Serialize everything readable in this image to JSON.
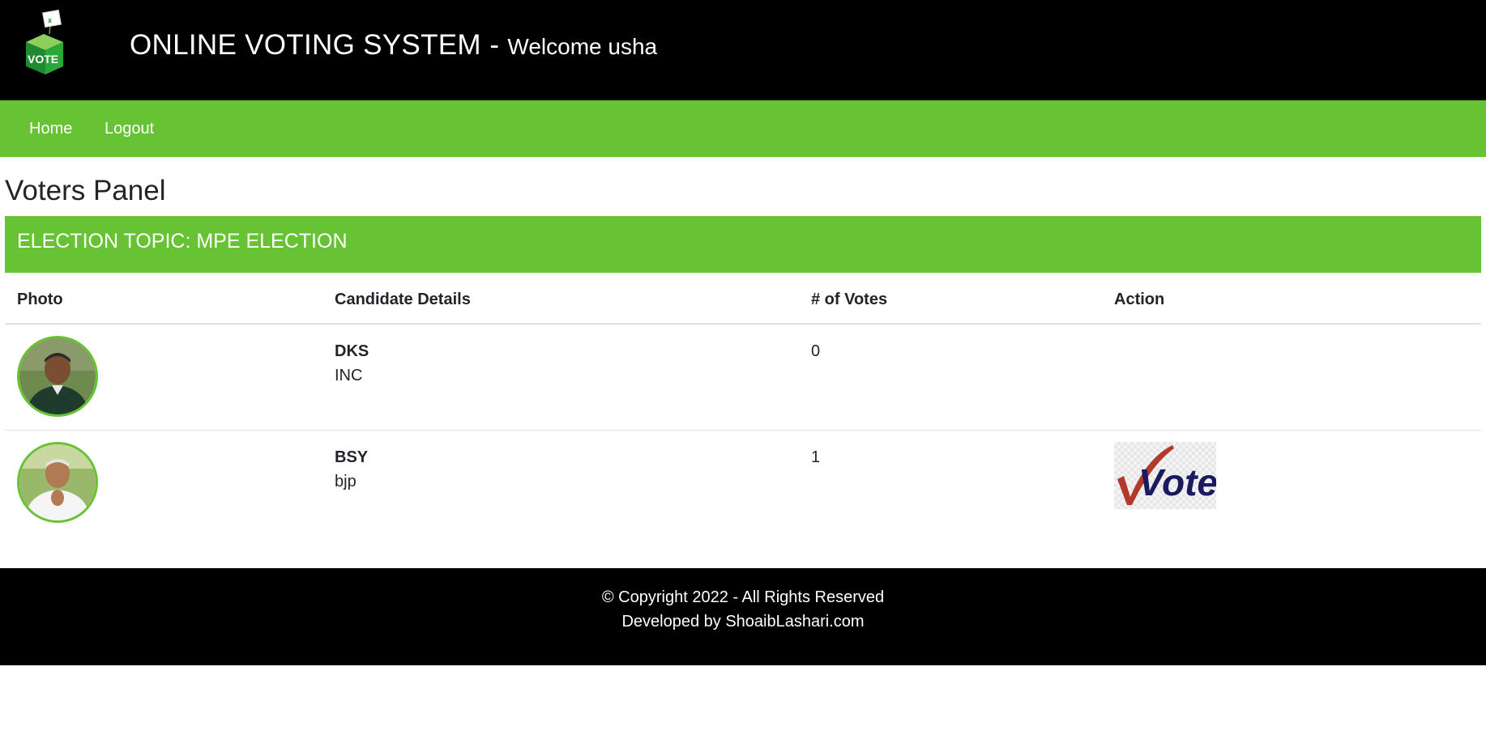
{
  "header": {
    "title": "ONLINE VOTING SYSTEM",
    "separator": "-",
    "welcome": "Welcome usha",
    "logo_icon": "vote-box-logo",
    "logo_text": "VOTE",
    "colors": {
      "background": "#000000",
      "accent": "#67c334"
    }
  },
  "nav": {
    "home": "Home",
    "logout": "Logout"
  },
  "page": {
    "title": "Voters Panel"
  },
  "election": {
    "topic": "ELECTION TOPIC: MPE ELECTION"
  },
  "table": {
    "headers": {
      "photo": "Photo",
      "details": "Candidate Details",
      "votes": "# of Votes",
      "action": "Action"
    },
    "rows": [
      {
        "name": "DKS",
        "party": "INC",
        "votes": "0",
        "photo_icon": "candidate-photo",
        "action": ""
      },
      {
        "name": "BSY",
        "party": "bjp",
        "votes": "1",
        "photo_icon": "candidate-photo",
        "action": "vote-button-image"
      }
    ]
  },
  "vote_image": {
    "text": "Vote",
    "icon": "checkmark-icon"
  },
  "footer": {
    "copyright": "© Copyright 2022 - All Rights Reserved",
    "developer": "Developed by ShoaibLashari.com"
  }
}
